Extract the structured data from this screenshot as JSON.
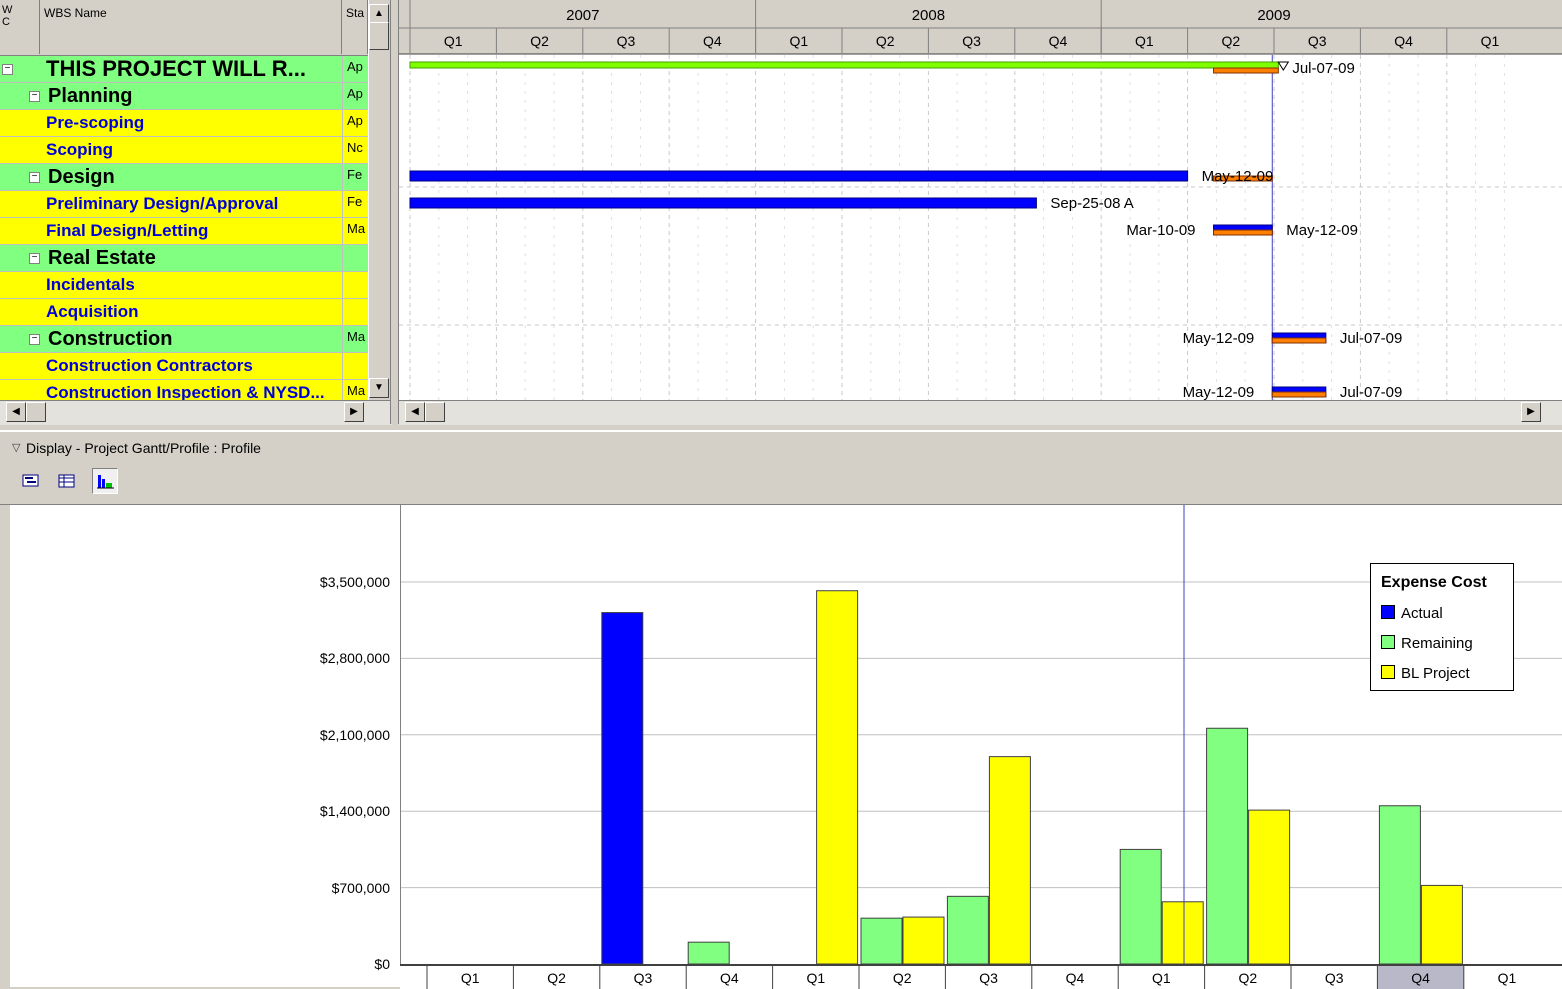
{
  "gantt": {
    "headers": {
      "wbs_code": "W\nC",
      "wbs_name": "WBS Name",
      "start": "Sta"
    },
    "rows": [
      {
        "name": "THIS PROJECT WILL R...",
        "start": "Ap",
        "level": 0,
        "color": "#80ff80"
      },
      {
        "name": "Planning",
        "start": "Ap",
        "level": 1,
        "color": "#80ff80"
      },
      {
        "name": "Pre-scoping",
        "start": "Ap",
        "level": 2,
        "color": "#ffff00"
      },
      {
        "name": "Scoping",
        "start": "Nc",
        "level": 2,
        "color": "#ffff00"
      },
      {
        "name": "Design",
        "start": "Fe",
        "level": 1,
        "color": "#80ff80"
      },
      {
        "name": "Preliminary Design/Approval",
        "start": "Fe",
        "level": 2,
        "color": "#ffff00"
      },
      {
        "name": "Final Design/Letting",
        "start": "Ma",
        "level": 2,
        "color": "#ffff00"
      },
      {
        "name": "Real Estate",
        "start": "",
        "level": 1,
        "color": "#80ff80"
      },
      {
        "name": "Incidentals",
        "start": "",
        "level": 2,
        "color": "#ffff00"
      },
      {
        "name": "Acquisition",
        "start": "",
        "level": 2,
        "color": "#ffff00"
      },
      {
        "name": "Construction",
        "start": "Ma",
        "level": 1,
        "color": "#80ff80"
      },
      {
        "name": "Construction Contractors",
        "start": "",
        "level": 2,
        "color": "#ffff00"
      },
      {
        "name": "Construction Inspection & NYSD...",
        "start": "Ma",
        "level": 2,
        "color": "#ffff00"
      }
    ],
    "years": [
      "2007",
      "2008",
      "2009"
    ],
    "quarters": [
      "Q1",
      "Q2",
      "Q3",
      "Q4",
      "Q1",
      "Q2",
      "Q3",
      "Q4",
      "Q1",
      "Q2",
      "Q3",
      "Q4",
      "Q1"
    ],
    "bars": [
      {
        "row": 0,
        "kind": "summary",
        "start_q": 0,
        "end_q": 10.05,
        "baseline_start_q": 9.3,
        "baseline_end_q": 10.05,
        "end_label": "Jul-07-09"
      },
      {
        "row": 4,
        "kind": "actual",
        "start_q": 0,
        "end_q": 9.0,
        "baseline_start_q": 9.3,
        "baseline_end_q": 9.98,
        "end_label": "May-12-09"
      },
      {
        "row": 5,
        "kind": "actual",
        "start_q": 0,
        "end_q": 7.25,
        "end_label": "Sep-25-08 A"
      },
      {
        "row": 6,
        "kind": "actual",
        "start_q": 9.3,
        "end_q": 9.98,
        "baseline_start_q": 9.3,
        "baseline_end_q": 9.98,
        "start_label": "Mar-10-09",
        "end_label": "May-12-09"
      },
      {
        "row": 10,
        "kind": "actual",
        "start_q": 9.98,
        "end_q": 10.6,
        "baseline_start_q": 9.98,
        "baseline_end_q": 10.6,
        "start_label": "May-12-09",
        "end_label": "Jul-07-09"
      },
      {
        "row": 12,
        "kind": "actual",
        "start_q": 9.98,
        "end_q": 10.6,
        "baseline_start_q": 9.98,
        "baseline_end_q": 10.6,
        "start_label": "May-12-09",
        "end_label": "Jul-07-09"
      }
    ],
    "data_date_q": 9.98
  },
  "panel": {
    "title": "Display - Project Gantt/Profile : Profile",
    "toolbar": [
      "gantt-view-icon",
      "table-view-icon",
      "profile-view-icon"
    ]
  },
  "chart_data": {
    "type": "bar",
    "title": "",
    "xlabel": "",
    "ylabel": "",
    "ylim": [
      0,
      3500000
    ],
    "y_ticks": [
      "$3,500,000",
      "$2,800,000",
      "$2,100,000",
      "$1,400,000",
      "$700,000",
      "$0"
    ],
    "categories": [
      "Q1",
      "Q2",
      "Q3",
      "Q4",
      "Q1",
      "Q2",
      "Q3",
      "Q4",
      "Q1",
      "Q2",
      "Q3",
      "Q4",
      "Q1"
    ],
    "series": [
      {
        "name": "Actual",
        "color": "#0000ff",
        "values": [
          0,
          0,
          3220000,
          0,
          0,
          0,
          0,
          0,
          0,
          0,
          0,
          0,
          0
        ]
      },
      {
        "name": "Remaining",
        "color": "#80ff80",
        "values": [
          0,
          0,
          0,
          200000,
          0,
          420000,
          620000,
          0,
          1050000,
          2160000,
          0,
          1450000,
          0
        ]
      },
      {
        "name": "BL Project",
        "color": "#ffff00",
        "values": [
          0,
          0,
          0,
          0,
          3420000,
          430000,
          1900000,
          0,
          570000,
          1410000,
          0,
          720000,
          0
        ]
      }
    ],
    "legend": {
      "title": "Expense Cost",
      "position": "top-right"
    },
    "grid": true,
    "highlighted_category": 11,
    "data_date_q": 8.75
  }
}
